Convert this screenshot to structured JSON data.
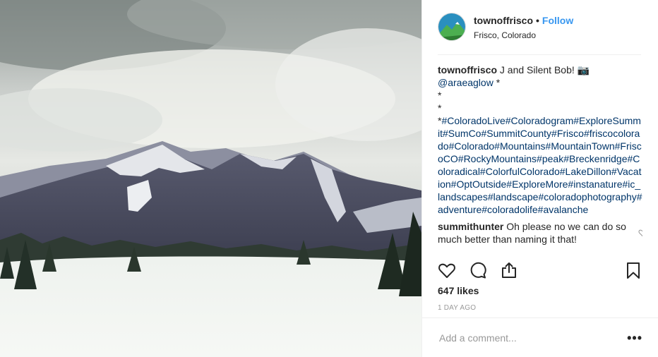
{
  "post": {
    "username": "townoffrisco",
    "separator": "•",
    "follow_label": "Follow",
    "location": "Frisco, Colorado"
  },
  "caption": {
    "username": "townoffrisco",
    "text": "J and Silent Bob! 📷",
    "mention": "@araeaglow",
    "mention_suffix": " *",
    "star1": "*",
    "star2": "*",
    "star3": "*",
    "hashtags": "#ColoradoLive#Coloradogram#ExploreSummit#SumCo#SummitCounty#Frisco#friscocolorado#Colorado#Mountains#MountainTown#FriscoCO#RockyMountains#peak#Breckenridge#Coloradical#ColorfulColorado#LakeDillon#Vacation#OptOutside#ExploreMore#instanature#ic_landscapes#landscape#coloradophotography#adventure#coloradolife#avalanche"
  },
  "comment": {
    "username": "summithunter",
    "text": "Oh please no we can do so much better than naming it that!"
  },
  "stats": {
    "likes": "647 likes",
    "time": "1 DAY AGO"
  },
  "composer": {
    "placeholder": "Add a comment...",
    "more": "•••"
  },
  "icons": {
    "like": "heart-icon",
    "comment": "comment-icon",
    "share": "share-icon",
    "save": "bookmark-icon",
    "comment_like": "small-heart-icon",
    "options": "more-options-icon"
  },
  "colors": {
    "follow": "#3897f0",
    "link": "#003569",
    "muted": "#999999",
    "text": "#262626"
  }
}
